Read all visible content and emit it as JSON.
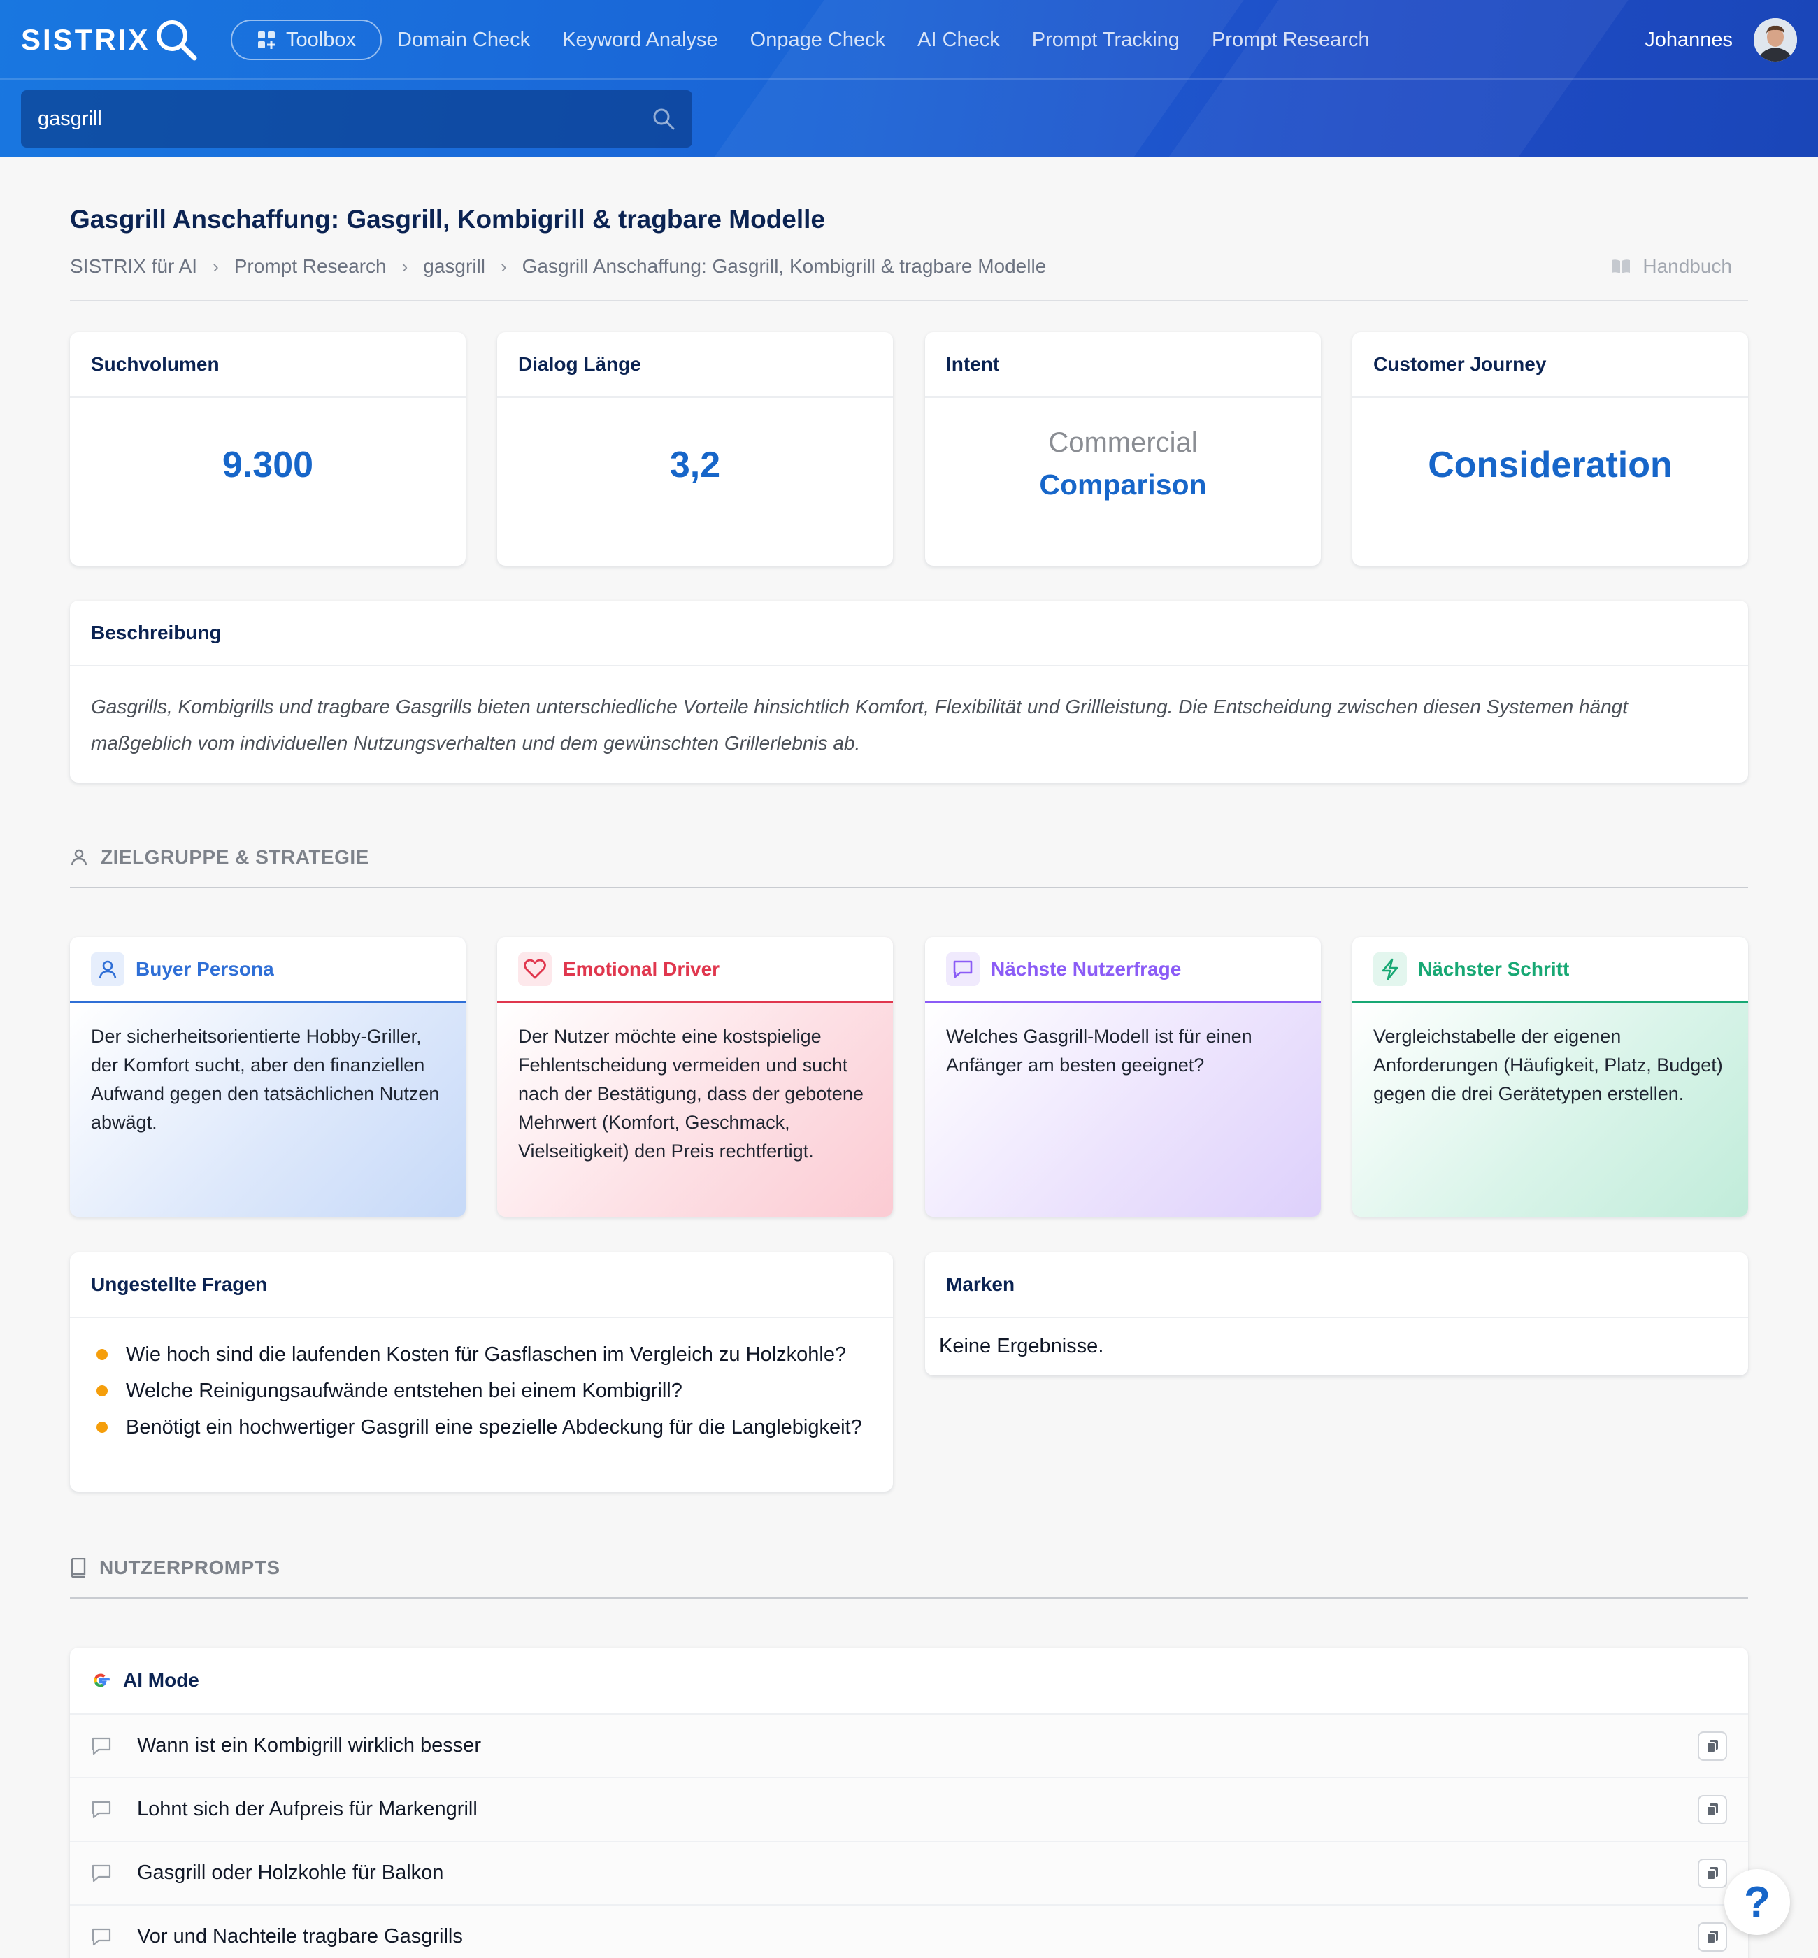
{
  "header": {
    "logo": "SISTRIX",
    "toolbox_label": "Toolbox",
    "nav": [
      "Domain Check",
      "Keyword Analyse",
      "Onpage Check",
      "AI Check",
      "Prompt Tracking",
      "Prompt Research"
    ],
    "user_name": "Johannes",
    "search_value": "gasgrill"
  },
  "page": {
    "title": "Gasgrill Anschaffung: Gasgrill, Kombigrill & tragbare Modelle",
    "breadcrumb": [
      "SISTRIX für AI",
      "Prompt Research",
      "gasgrill",
      "Gasgrill Anschaffung: Gasgrill, Kombigrill & tragbare Modelle"
    ],
    "handbuch_label": "Handbuch"
  },
  "kpis": {
    "suchvolumen": {
      "label": "Suchvolumen",
      "value": "9.300"
    },
    "dialog": {
      "label": "Dialog Länge",
      "value": "3,2"
    },
    "intent": {
      "label": "Intent",
      "primary": "Commercial",
      "secondary": "Comparison"
    },
    "journey": {
      "label": "Customer Journey",
      "value": "Consideration"
    }
  },
  "beschreibung": {
    "label": "Beschreibung",
    "text": "Gasgrills, Kombigrills und tragbare Gasgrills bieten unterschiedliche Vorteile hinsichtlich Komfort, Flexibilität und Grillleistung. Die Entscheidung zwischen diesen Systemen hängt maßgeblich vom individuellen Nutzungsverhalten und dem gewünschten Grillerlebnis ab."
  },
  "zielgruppe": {
    "section_label": "ZIELGRUPPE & STRATEGIE",
    "cards": [
      {
        "title": "Buyer Persona",
        "icon": "user-icon",
        "color": "#2f6fd6",
        "text": "Der sicherheitsorientierte Hobby-Griller, der Komfort sucht, aber den finanziellen Aufwand gegen den tatsächlichen Nutzen abwägt."
      },
      {
        "title": "Emotional Driver",
        "icon": "heart-icon",
        "color": "#e0374e",
        "text": "Der Nutzer möchte eine kostspielige Fehlentscheidung vermeiden und sucht nach der Bestätigung, dass der gebotene Mehrwert (Komfort, Geschmack, Vielseitigkeit) den Preis rechtfertigt."
      },
      {
        "title": "Nächste Nutzerfrage",
        "icon": "chat-icon",
        "color": "#8b5cf6",
        "text": "Welches Gasgrill-Modell ist für einen Anfänger am besten geeignet?"
      },
      {
        "title": "Nächster Schritt",
        "icon": "bolt-icon",
        "color": "#18a874",
        "text": "Vergleichstabelle der eigenen Anforderungen (Häufigkeit, Platz, Budget) gegen die drei Gerätetypen erstellen."
      }
    ]
  },
  "fragen": {
    "label": "Ungestellte Fragen",
    "items": [
      "Wie hoch sind die laufenden Kosten für Gasflaschen im Vergleich zu Holzkohle?",
      "Welche Reinigungsaufwände entstehen bei einem Kombigrill?",
      "Benötigt ein hochwertiger Gasgrill eine spezielle Abdeckung für die Langlebigkeit?"
    ]
  },
  "marken": {
    "label": "Marken",
    "empty_text": "Keine Ergebnisse."
  },
  "nutzerprompts": {
    "section_label": "NUTZERPROMPTS",
    "source_label": "AI Mode",
    "items": [
      "Wann ist ein Kombigrill wirklich besser",
      "Lohnt sich der Aufpreis für Markengrill",
      "Gasgrill oder Holzkohle für Balkon",
      "Vor und Nachteile tragbare Gasgrills"
    ]
  },
  "help_label": "?"
}
